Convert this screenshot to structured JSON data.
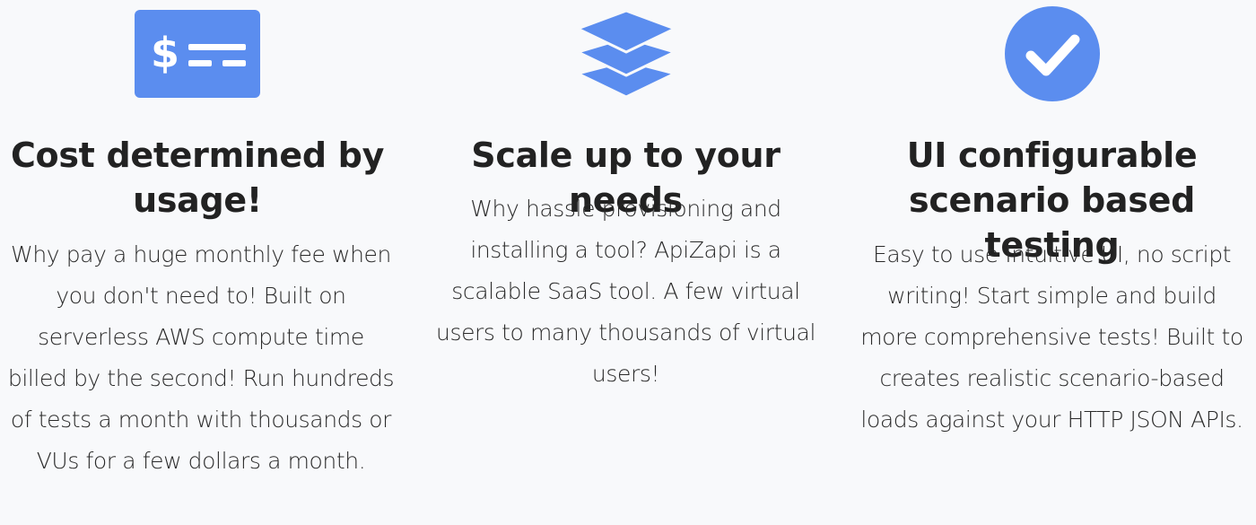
{
  "colors": {
    "accent": "#5b8def",
    "background": "#f8f9fb",
    "heading": "#222222",
    "body_text": "#2a2a2a"
  },
  "features": [
    {
      "icon": "money-bill-icon",
      "title": "Cost determined by usage!",
      "description": "Why pay a huge monthly fee when you don't need to! Built on serverless AWS compute time billed by the second! Run hundreds of tests a month with thousands or VUs for a few dollars a month."
    },
    {
      "icon": "layers-icon",
      "title": "Scale up to your needs",
      "description": "Why hassle provisioning and installing a tool? ApiZapi is a scalable SaaS tool. A few virtual users to many thousands of virtual users!"
    },
    {
      "icon": "check-circle-icon",
      "title": "UI configurable scenario based testing",
      "description": "Easy to use Intuitive UI, no script writing! Start simple and build more comprehensive tests! Built to creates realistic scenario-based loads against your HTTP JSON APIs."
    }
  ]
}
